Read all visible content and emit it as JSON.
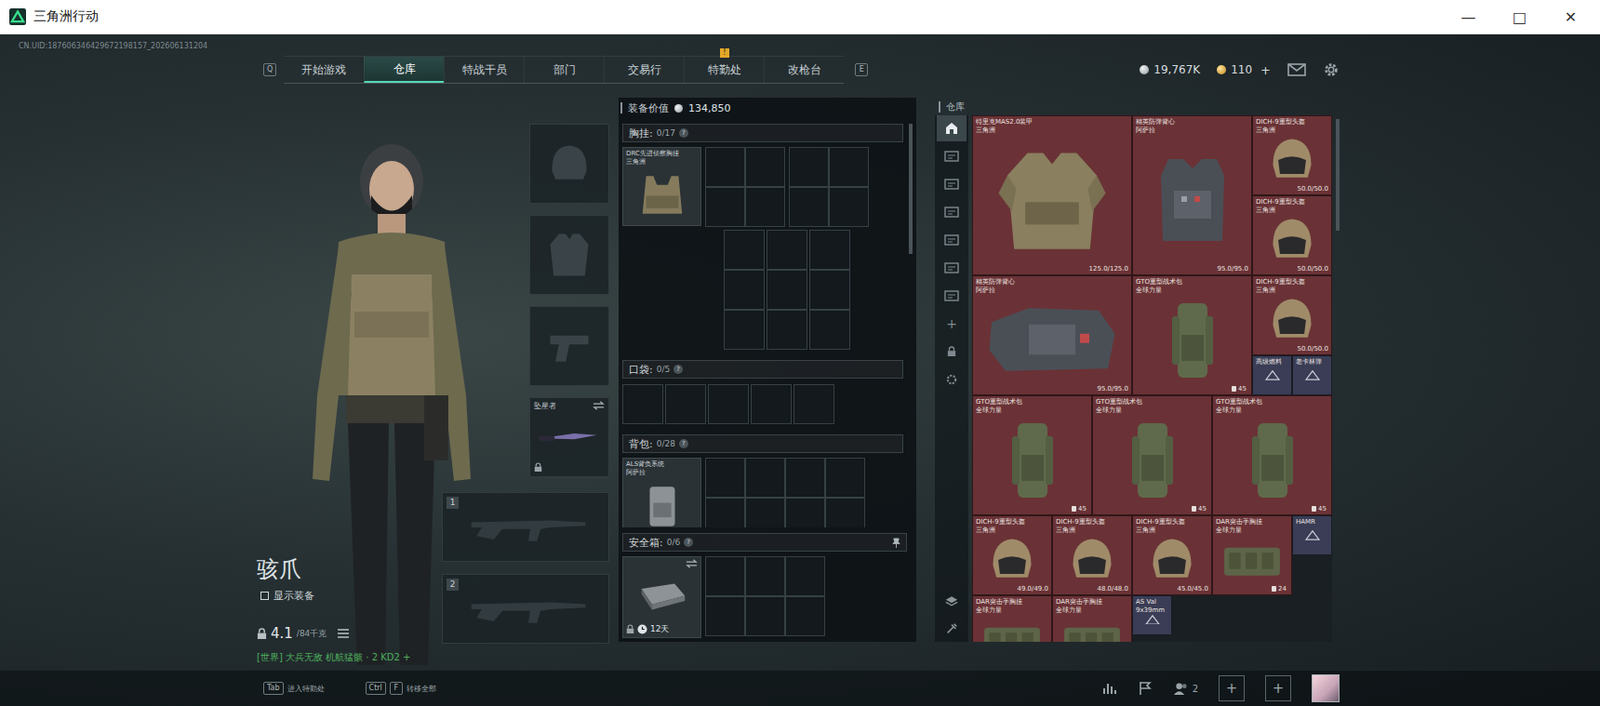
{
  "window": {
    "title": "三角洲行动",
    "controls": [
      "—",
      "□",
      "✕"
    ]
  },
  "uid": "CN.UID:187606346429672198157_202606131204",
  "nav": {
    "prev_key": "Q",
    "next_key": "E",
    "tabs": [
      {
        "label": "开始游戏",
        "selected": false,
        "badge": ""
      },
      {
        "label": "仓库",
        "selected": true,
        "badge": ""
      },
      {
        "label": "特战干员",
        "selected": false,
        "badge": ""
      },
      {
        "label": "部门",
        "selected": false,
        "badge": ""
      },
      {
        "label": "交易行",
        "selected": false,
        "badge": ""
      },
      {
        "label": "特勤处",
        "selected": false,
        "badge": "!"
      },
      {
        "label": "改枪台",
        "selected": false,
        "badge": ""
      }
    ]
  },
  "currency": {
    "coins": "19,767K",
    "tickets": "110",
    "add": "+"
  },
  "operator": {
    "name": "骇爪",
    "show_gear": {
      "label": "显示装备",
      "checked": false
    },
    "weight": "4.1",
    "capacity": "/84千克",
    "status": "[世界] 大兵无敌 机航猛骸 · 2 KD2 +"
  },
  "gear_slots": [
    {
      "kind": "helmet",
      "label": "",
      "filled": false,
      "locked": false
    },
    {
      "kind": "armor",
      "label": "",
      "filled": false,
      "locked": false
    },
    {
      "kind": "pistol",
      "label": "",
      "filled": false,
      "locked": false
    },
    {
      "kind": "melee",
      "label": "坠星者",
      "filled": true,
      "locked": true
    }
  ],
  "weapon_slots": [
    {
      "number": "1",
      "filled": false
    },
    {
      "number": "2",
      "filled": false
    }
  ],
  "loadout": {
    "value_label": "装备价值",
    "value": "134,850",
    "chest": {
      "label": "胸挂:",
      "count": "0/17",
      "help": "?",
      "item": {
        "name": "DRC先进侦察胸挂",
        "faction": "三角洲"
      }
    },
    "pockets": {
      "label": "口袋:",
      "count": "0/5",
      "help": "?"
    },
    "backpack": {
      "label": "背包:",
      "count": "0/28",
      "help": "?",
      "item": {
        "name": "ALS背负系统",
        "faction": "阿萨拉"
      }
    },
    "safe": {
      "label": "安全箱:",
      "count": "0/6",
      "help": "?",
      "timer": "12天",
      "locked": true
    }
  },
  "stash": {
    "title": "仓库",
    "tabs": [
      {
        "selected": true
      },
      {
        "selected": false
      },
      {
        "selected": false
      },
      {
        "selected": false
      },
      {
        "selected": false
      },
      {
        "selected": false
      },
      {
        "selected": false
      }
    ],
    "add": "+",
    "items": [
      {
        "kind": "armor",
        "name": "特里克MAS2.0装甲",
        "faction": "三角洲",
        "durability": "125.0/125.0",
        "count": "",
        "color": "#6a3236"
      },
      {
        "kind": "vest",
        "name": "精英防弹背心",
        "faction": "阿萨拉",
        "durability": "95.0/95.0",
        "count": "",
        "color": "#6a3236"
      },
      {
        "kind": "helmet",
        "name": "DICH-9重型头盔",
        "faction": "三角洲",
        "durability": "50.0/50.0",
        "count": "",
        "color": "#6a3236"
      },
      {
        "kind": "helmet",
        "name": "DICH-9重型头盔",
        "faction": "三角洲",
        "durability": "50.0/50.0",
        "count": "",
        "color": "#6a3236"
      },
      {
        "kind": "plate",
        "name": "精英防弹背心",
        "faction": "阿萨拉",
        "durability": "95.0/95.0",
        "count": "",
        "color": "#6a3236"
      },
      {
        "kind": "pack",
        "name": "GTO重型战术包",
        "faction": "全球力量",
        "durability": "",
        "count": "45",
        "color": "#6a3236"
      },
      {
        "kind": "helmet",
        "name": "DICH-9重型头盔",
        "faction": "三角洲",
        "durability": "50.0/50.0",
        "count": "",
        "color": "#6a3236"
      },
      {
        "kind": "small",
        "name": "高级燃料",
        "faction": "",
        "durability": "",
        "count": "",
        "color": "#3a3d55"
      },
      {
        "kind": "small",
        "name": "老卡林弹",
        "faction": "",
        "durability": "",
        "count": "",
        "color": "#3a3d55"
      },
      {
        "kind": "pack",
        "name": "GTO重型战术包",
        "faction": "全球力量",
        "durability": "",
        "count": "45",
        "color": "#6a3236"
      },
      {
        "kind": "pack",
        "name": "GTO重型战术包",
        "faction": "全球力量",
        "durability": "",
        "count": "45",
        "color": "#6a3236"
      },
      {
        "kind": "pack",
        "name": "GTO重型战术包",
        "faction": "全球力量",
        "durability": "",
        "count": "45",
        "color": "#6a3236"
      },
      {
        "kind": "helmet",
        "name": "DICH-9重型头盔",
        "faction": "三角洲",
        "durability": "49.0/49.0",
        "count": "",
        "color": "#6a3236"
      },
      {
        "kind": "helmet",
        "name": "DICH-9重型头盔",
        "faction": "三角洲",
        "durability": "48.0/48.0",
        "count": "",
        "color": "#6a3236"
      },
      {
        "kind": "helmet",
        "name": "DICH-9重型头盔",
        "faction": "三角洲",
        "durability": "45.0/45.0",
        "count": "",
        "color": "#6a3236"
      },
      {
        "kind": "rig",
        "name": "DAR突击手胸挂",
        "faction": "全球力量",
        "durability": "",
        "count": "24",
        "color": "#6a3236"
      },
      {
        "kind": "small",
        "name": "HAMR",
        "faction": "",
        "durability": "",
        "count": "",
        "color": "#3a3d55"
      },
      {
        "kind": "rig",
        "name": "DAR突击手胸挂",
        "faction": "全球力量",
        "durability": "",
        "count": "",
        "color": "#6a3236"
      },
      {
        "kind": "rig",
        "name": "DAR突击手胸挂",
        "faction": "全球力量",
        "durability": "",
        "count": "",
        "color": "#6a3236"
      },
      {
        "kind": "small",
        "name": "AS Val",
        "faction": "9x39mm",
        "durability": "",
        "count": "",
        "color": "#3a3d55"
      }
    ]
  },
  "bottom_bar": {
    "hints": [
      {
        "keys": [
          "Tab"
        ],
        "label": "进入特勤处"
      },
      {
        "keys": [
          "Ctrl",
          "F"
        ],
        "label": "转移全部"
      }
    ],
    "friends": "2",
    "add_buttons": [
      "+",
      "+"
    ]
  }
}
